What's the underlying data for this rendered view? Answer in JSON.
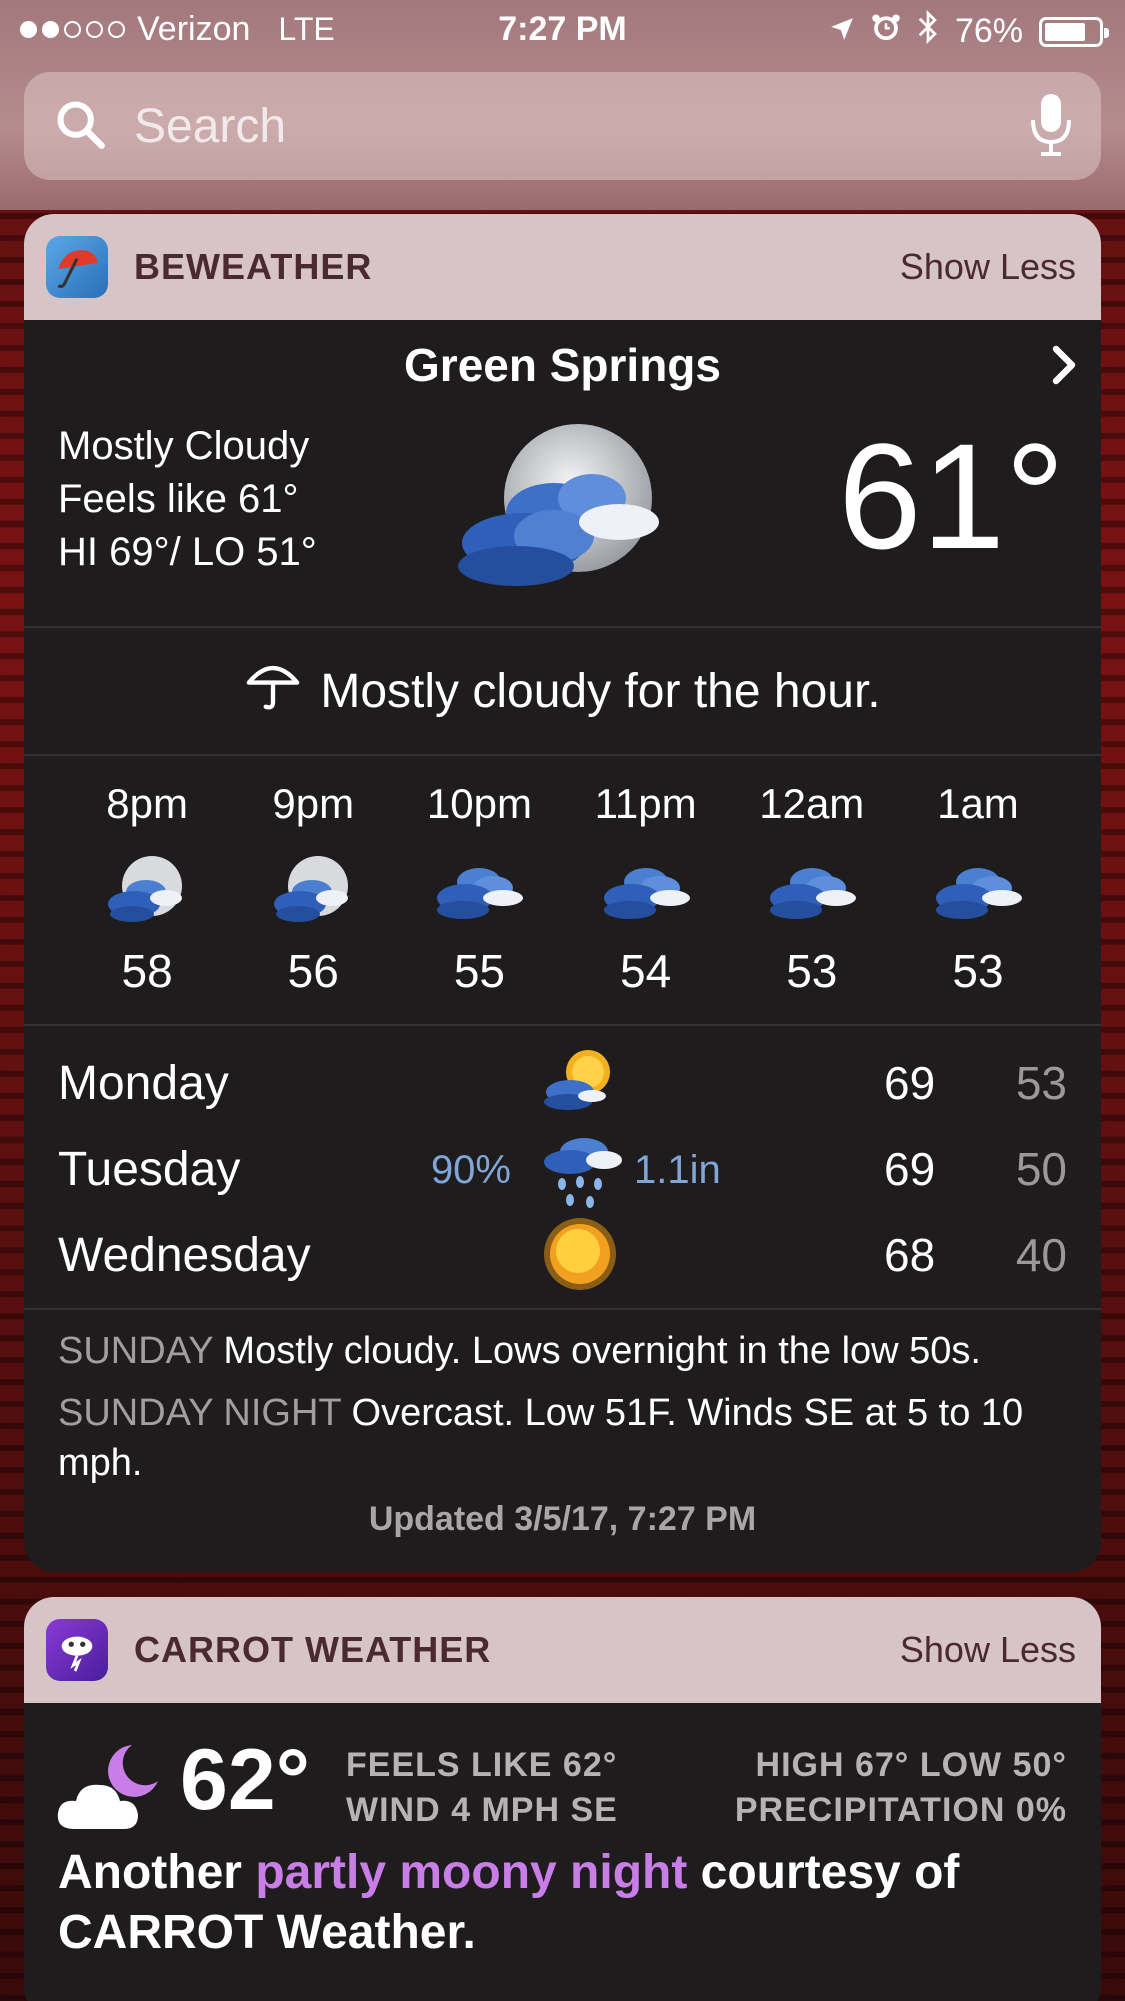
{
  "status_bar": {
    "carrier": "Verizon",
    "network": "LTE",
    "time": "7:27 PM",
    "battery": "76%",
    "battery_level": 0.76,
    "signal_bars_filled": 2,
    "icons": [
      "location-arrow-icon",
      "alarm-clock-icon",
      "bluetooth-icon",
      "battery-icon"
    ]
  },
  "search": {
    "placeholder": "Search",
    "icons": [
      "search-icon",
      "microphone-icon"
    ]
  },
  "beweather": {
    "app_name": "BEWEATHER",
    "action": "Show Less",
    "city": "Green Springs",
    "condition": "Mostly Cloudy",
    "feels_like": "Feels like 61°",
    "hi_lo": "HI 69°/ LO 51°",
    "temperature": "61°",
    "hour_summary": "Mostly cloudy for the hour.",
    "hourly": [
      {
        "time": "8pm",
        "temp": "58",
        "icon": "moon-cloud-icon"
      },
      {
        "time": "9pm",
        "temp": "56",
        "icon": "moon-cloud-icon"
      },
      {
        "time": "10pm",
        "temp": "55",
        "icon": "clouds-icon"
      },
      {
        "time": "11pm",
        "temp": "54",
        "icon": "clouds-icon"
      },
      {
        "time": "12am",
        "temp": "53",
        "icon": "clouds-icon"
      },
      {
        "time": "1am",
        "temp": "53",
        "icon": "clouds-icon"
      }
    ],
    "daily": [
      {
        "day": "Monday",
        "pct": "",
        "amount": "",
        "hi": "69",
        "lo": "53",
        "icon": "sun-cloud-icon"
      },
      {
        "day": "Tuesday",
        "pct": "90%",
        "amount": "1.1in",
        "hi": "69",
        "lo": "50",
        "icon": "rain-cloud-icon"
      },
      {
        "day": "Wednesday",
        "pct": "",
        "amount": "",
        "hi": "68",
        "lo": "40",
        "icon": "sun-icon"
      }
    ],
    "forecast": [
      {
        "label": "SUNDAY",
        "text": "Mostly cloudy. Lows overnight in the low 50s."
      },
      {
        "label": "SUNDAY NIGHT",
        "text": "Overcast. Low 51F. Winds SE at 5 to 10 mph."
      }
    ],
    "updated": "Updated 3/5/17, 7:27 PM"
  },
  "carrot": {
    "app_name": "CARROT WEATHER",
    "action": "Show Less",
    "temperature": "62°",
    "feels_like": "FEELS LIKE 62°",
    "wind": "WIND 4 MPH SE",
    "high_low": "HIGH 67° LOW 50°",
    "precipitation": "PRECIPITATION 0%",
    "quote_before": "Another ",
    "quote_highlight": "partly moony night",
    "quote_after": " courtesy of CARROT Weather."
  },
  "colors": {
    "widget_bg": "#1e1c1d",
    "header_bg": "#d6c4c6",
    "accent_blue": "#7fa6d6",
    "highlight_purple": "#c97de6"
  }
}
